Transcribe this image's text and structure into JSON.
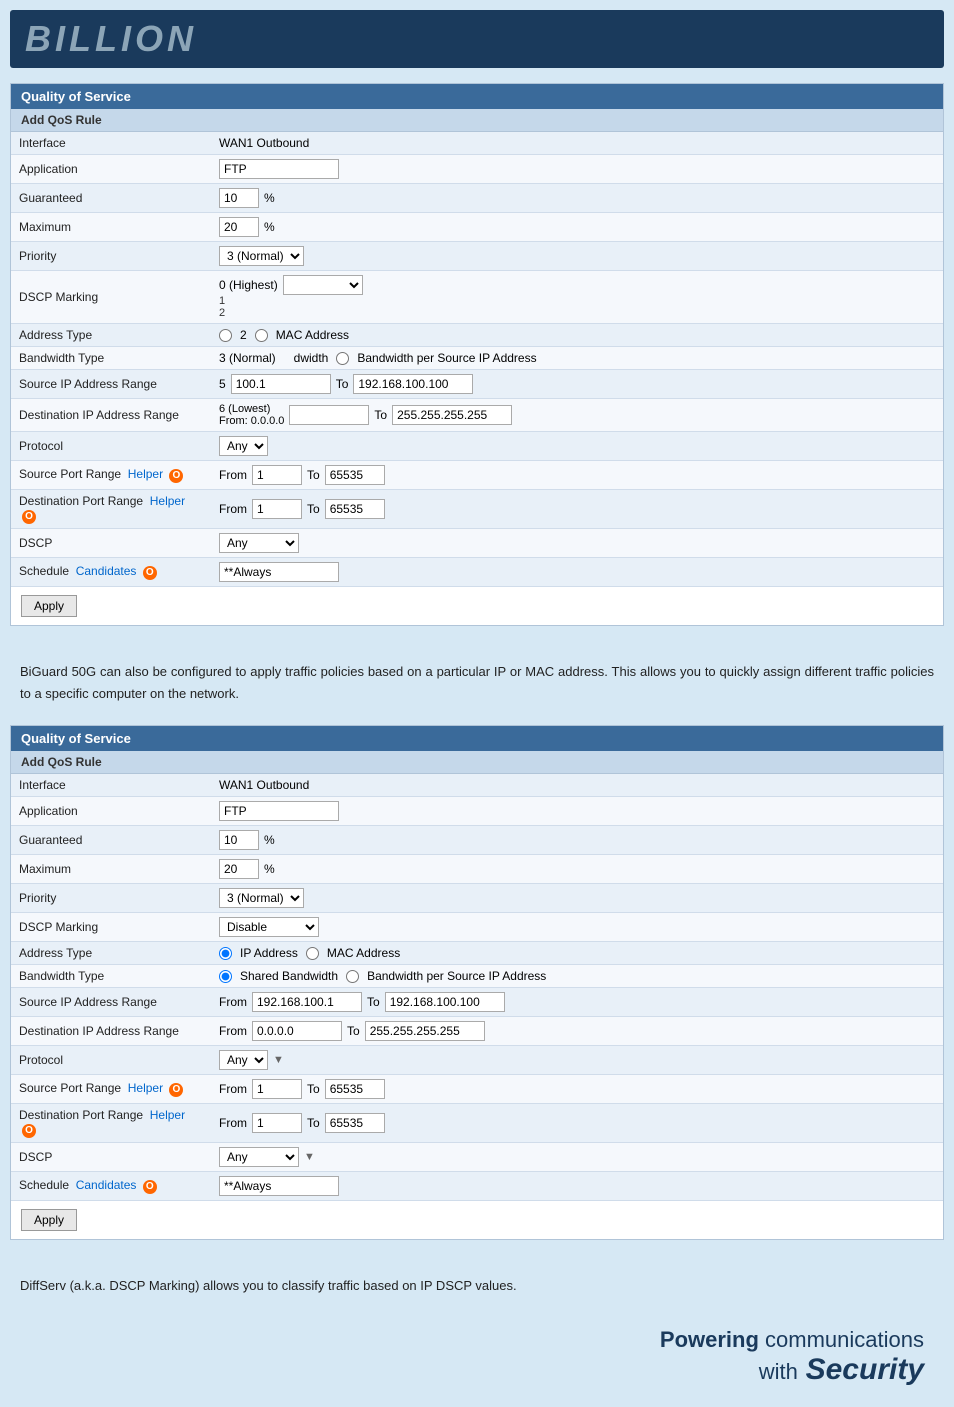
{
  "logo": {
    "text": "BILLION"
  },
  "table1": {
    "title": "Quality of Service",
    "subtitle": "Add QoS Rule",
    "rows": [
      {
        "label": "Interface",
        "value": "WAN1 Outbound"
      },
      {
        "label": "Application",
        "value": "FTP"
      },
      {
        "label": "Guaranteed",
        "value1": "10",
        "value2": "%"
      },
      {
        "label": "Maximum",
        "value1": "20",
        "value2": "%"
      },
      {
        "label": "Priority",
        "select_val": "3 (Normal)"
      },
      {
        "label": "DSCP Marking",
        "select_val2": "0 (Highest)"
      },
      {
        "label": "Address Type",
        "radio1": "2",
        "radio2": "MAC Address"
      },
      {
        "label": "Bandwidth Type",
        "radio3": "3 (Normal)",
        "radio4": "Bandwidth",
        "radio5": "Bandwidth per Source IP Address"
      },
      {
        "label": "Source IP Address Range",
        "from": "100.1",
        "to": "192.168.100.100"
      },
      {
        "label": "Destination IP Address Range",
        "from2": "6 (Lowest)\nFrom: 0.0.0.0",
        "to2": "255.255.255.255"
      },
      {
        "label": "Protocol",
        "sel": "Any"
      },
      {
        "label": "Source Port Range",
        "helper": "Helper",
        "from3": "1",
        "to3": "65535"
      },
      {
        "label": "Destination Port Range",
        "helper2": "Helper",
        "from4": "1",
        "to4": "65535"
      },
      {
        "label": "DSCP",
        "sel2": "Any"
      },
      {
        "label": "Schedule",
        "candidates": "Candidates",
        "val": "**Always"
      }
    ],
    "apply_label": "Apply"
  },
  "desc1": {
    "text": "BiGuard 50G can also be configured to apply traffic policies based on a particular IP or MAC address. This allows you to quickly assign different traffic policies to a specific computer on the network."
  },
  "table2": {
    "title": "Quality of Service",
    "subtitle": "Add QoS Rule",
    "rows": [
      {
        "label": "Interface",
        "value": "WAN1 Outbound"
      },
      {
        "label": "Application",
        "value": "FTP"
      },
      {
        "label": "Guaranteed",
        "value1": "10",
        "value2": "%"
      },
      {
        "label": "Maximum",
        "value1": "20",
        "value2": "%"
      },
      {
        "label": "Priority",
        "select_val": "3 (Normal)"
      },
      {
        "label": "DSCP Marking",
        "select_val2": "Disable"
      },
      {
        "label": "Address Type",
        "radio_ip": "IP Address",
        "radio_mac": "MAC Address"
      },
      {
        "label": "Bandwidth Type",
        "radio_shared": "Shared Bandwidth",
        "radio_bw": "Bandwidth per Source IP Address"
      },
      {
        "label": "Source IP Address Range",
        "from": "192.168.100.1",
        "to": "192.168.100.100"
      },
      {
        "label": "Destination IP Address Range",
        "from2": "0.0.0.0",
        "to2": "255.255.255.255"
      },
      {
        "label": "Protocol",
        "sel": "Any"
      },
      {
        "label": "Source Port Range",
        "helper": "Helper",
        "from3": "1",
        "to3": "65535"
      },
      {
        "label": "Destination Port Range",
        "helper2": "Helper",
        "from4": "1",
        "to4": "65535"
      },
      {
        "label": "DSCP",
        "sel2": "Any"
      },
      {
        "label": "Schedule",
        "candidates": "Candidates",
        "val": "**Always"
      }
    ],
    "apply_label": "Apply"
  },
  "desc2": {
    "text": "DiffServ (a.k.a. DSCP Marking) allows you to classify traffic based on IP DSCP values."
  },
  "footer": {
    "powering": "Powering",
    "communications": "communications",
    "with": "with",
    "security": "Security"
  }
}
